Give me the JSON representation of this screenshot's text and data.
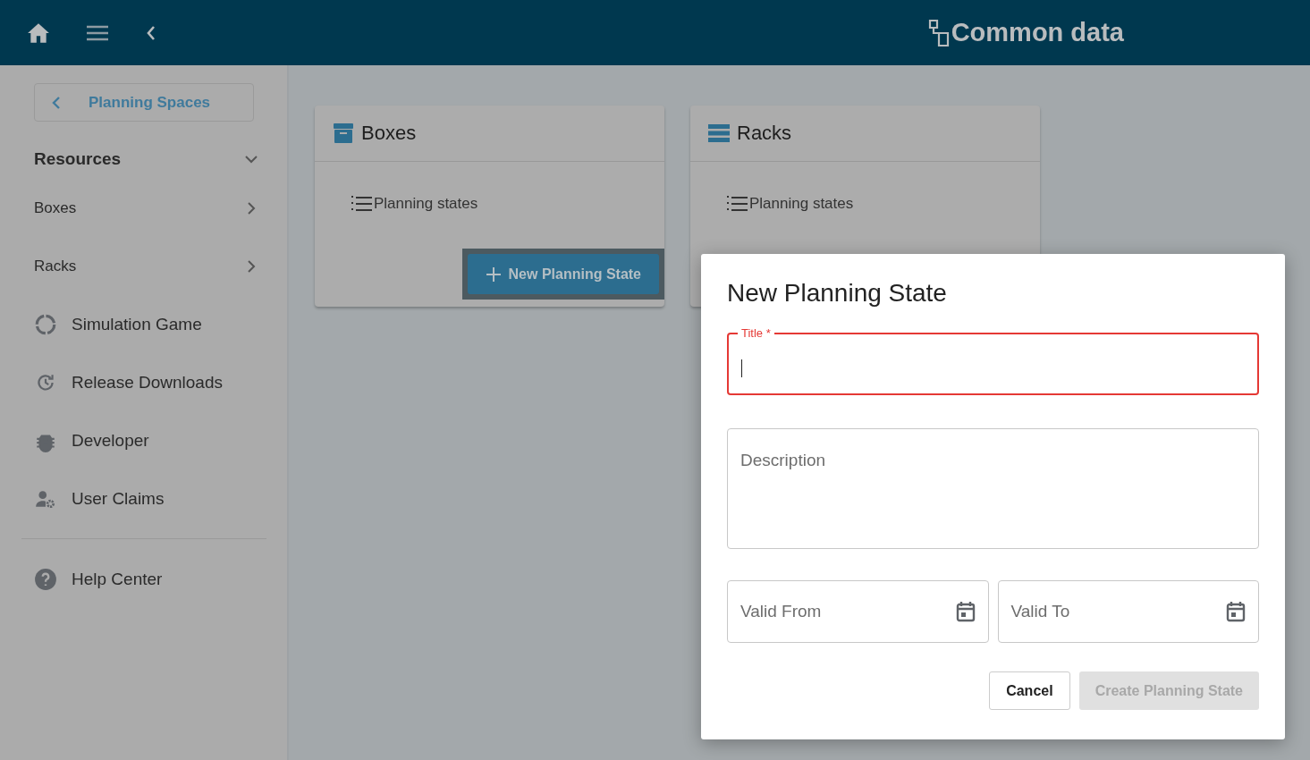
{
  "header": {
    "title": "Common data"
  },
  "sidebar": {
    "back_button": "Planning Spaces",
    "items": [
      {
        "kind": "group",
        "label": "Resources",
        "expanded": true
      },
      {
        "kind": "sub",
        "label": "Boxes",
        "expanded": false
      },
      {
        "kind": "sub",
        "label": "Racks",
        "expanded": false
      },
      {
        "kind": "link",
        "label": "Simulation Game"
      },
      {
        "kind": "link",
        "label": "Release Downloads"
      },
      {
        "kind": "link",
        "label": "Developer"
      },
      {
        "kind": "link",
        "label": "User Claims"
      },
      {
        "kind": "divider"
      },
      {
        "kind": "link",
        "label": "Help Center"
      }
    ]
  },
  "cards": [
    {
      "title": "Boxes",
      "link": "Planning states",
      "button": "New Planning State",
      "focused": true
    },
    {
      "title": "Racks",
      "link": "Planning states"
    }
  ],
  "dialog": {
    "title": "New Planning State",
    "title_field": {
      "label": "Title *",
      "invalid": true
    },
    "description_field": {
      "placeholder": "Description"
    },
    "date_fields": [
      {
        "placeholder": "Valid From"
      },
      {
        "placeholder": "Valid To"
      }
    ],
    "buttons": [
      {
        "label": "Cancel",
        "disabled": false
      },
      {
        "label": "Create Planning State",
        "disabled": true
      }
    ]
  }
}
